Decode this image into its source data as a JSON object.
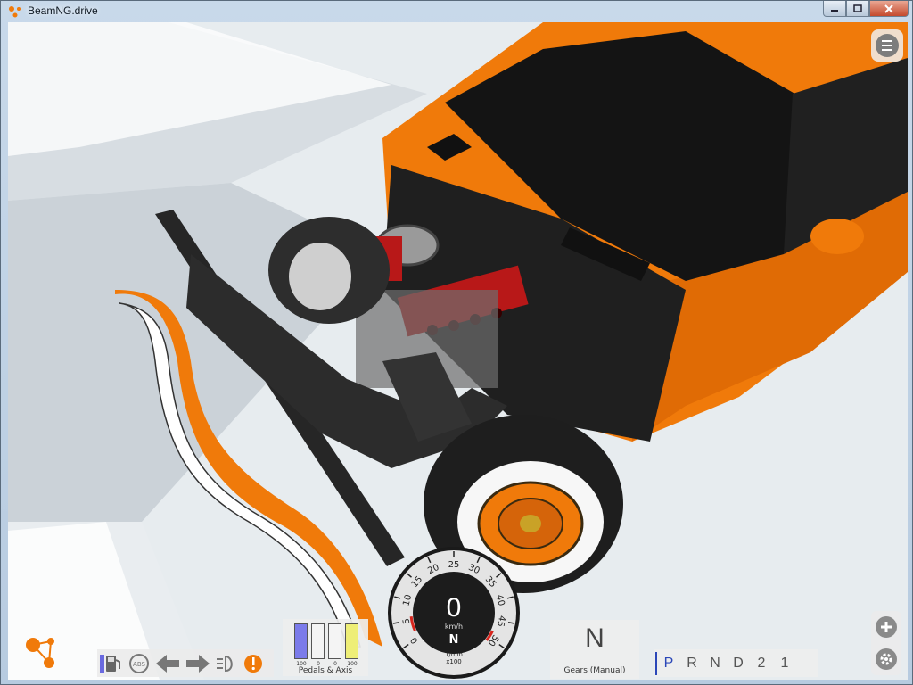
{
  "window": {
    "title": "BeamNG.drive",
    "controls": [
      "minimize",
      "maximize",
      "close"
    ]
  },
  "hud": {
    "menu_icon": "hamburger-menu-icon",
    "status_icons": [
      "fuel-icon",
      "abs-icon",
      "left-arrow-icon",
      "right-arrow-icon",
      "headlight-icon",
      "warning-icon"
    ],
    "abs_label": "ABS",
    "pedals": {
      "label": "Pedals & Axis",
      "values": [
        "100",
        "0",
        "0",
        "100"
      ],
      "fills": [
        1.0,
        0.0,
        0.0,
        1.0
      ],
      "colors": [
        "#7b7bea",
        "#7b7bea",
        "#7b7bea",
        "#eeee77"
      ]
    },
    "tachometer": {
      "ticks": [
        "0",
        "5",
        "10",
        "15",
        "20",
        "25",
        "30",
        "35",
        "40",
        "45",
        "50"
      ],
      "speed": "0",
      "speed_unit": "km/h",
      "gear": "N",
      "rpm_unit_line1": "1/min",
      "rpm_unit_line2": "x100"
    },
    "gearbox": {
      "current": "N",
      "label": "Gears (Manual)"
    },
    "shifter": {
      "positions": [
        "P",
        "R",
        "N",
        "D",
        "2",
        "1"
      ],
      "active": "P"
    },
    "side_tools": [
      "add-icon",
      "settings-icon"
    ],
    "colors": {
      "accent_red": "#d7261e",
      "shifter_blue": "#2b47b8",
      "car_orange": "#f07a0a"
    }
  }
}
